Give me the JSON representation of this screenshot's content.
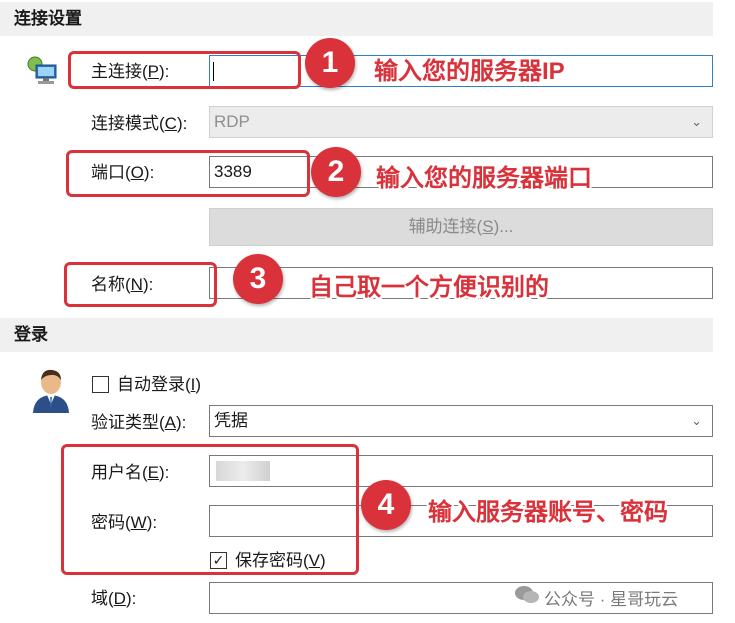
{
  "connection": {
    "section_title": "连接设置",
    "primary_label": "主连接(P):",
    "primary_value": "",
    "mode_label": "连接模式(C):",
    "mode_value": "RDP",
    "port_label": "端口(O):",
    "port_value": "3389",
    "aux_button": "辅助连接(S)...",
    "name_label": "名称(N):",
    "name_value": ""
  },
  "login": {
    "section_title": "登录",
    "auto_login": "自动登录(I)",
    "auto_login_checked": false,
    "auth_label": "验证类型(A):",
    "auth_value": "凭据",
    "user_label": "用户名(E):",
    "password_label": "密码(W):",
    "save_password": "保存密码(V)",
    "save_password_checked": true,
    "domain_label": "域(D):",
    "domain_value": ""
  },
  "annotations": {
    "n1": "1",
    "t1": "输入您的服务器IP",
    "n2": "2",
    "t2": "输入您的服务器端口",
    "n3": "3",
    "t3": "自己取一个方便识别的",
    "n4": "4",
    "t4": "输入服务器账号、密码"
  },
  "watermark": "公众号 · 星哥玩云",
  "colors": {
    "annotation_red": "#d9323b",
    "focus_blue": "#2f7fc4"
  }
}
